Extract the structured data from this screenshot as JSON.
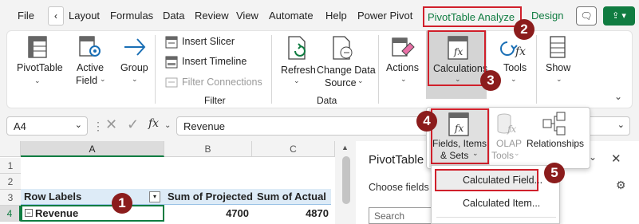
{
  "menu": {
    "file": "File",
    "layout": "Layout",
    "formulas": "Formulas",
    "data": "Data",
    "review": "Review",
    "view": "View",
    "automate": "Automate",
    "help": "Help",
    "power_pivot": "Power Pivot",
    "pivottable_analyze": "PivotTable Analyze",
    "design": "Design"
  },
  "ribbon": {
    "pivottable": "PivotTable",
    "active_field_1": "Active",
    "active_field_2": "Field",
    "group": "Group",
    "insert_slicer": "Insert Slicer",
    "insert_timeline": "Insert Timeline",
    "filter_connections": "Filter Connections",
    "filter_group": "Filter",
    "refresh": "Refresh",
    "change_data_source_1": "Change Data",
    "change_data_source_2": "Source",
    "data_group": "Data",
    "actions": "Actions",
    "calculations": "Calculations",
    "tools": "Tools",
    "show": "Show"
  },
  "formula_bar": {
    "name_box": "A4",
    "fx": "fx",
    "value": "Revenue"
  },
  "grid": {
    "columns": [
      "A",
      "B",
      "C"
    ],
    "rows": [
      "1",
      "2",
      "3",
      "4"
    ],
    "row_labels_header": "Row Labels",
    "sum_projected_header": "Sum of Projected",
    "sum_actual_header": "Sum of Actual",
    "revenue_label": "Revenue",
    "revenue_projected": "4700",
    "revenue_actual": "4870"
  },
  "pivot_panel": {
    "title": "PivotTable",
    "choose_fields": "Choose fields t",
    "search_placeholder": "Search"
  },
  "calc_dropdown": {
    "fields_items_sets_1": "Fields, Items,",
    "fields_items_sets_2": "& Sets",
    "olap_tools_1": "OLAP",
    "olap_tools_2": "Tools",
    "relationships": "Relationships",
    "calculated_field": "Calculated Field...",
    "calculated_item": "Calculated Item..."
  },
  "callouts": [
    "1",
    "2",
    "3",
    "4",
    "5"
  ],
  "colors": {
    "excel_green": "#107c41",
    "highlight_red": "#d0202b",
    "badge_red": "#8b1c1c",
    "pivot_header_blue": "#ddebf7"
  }
}
